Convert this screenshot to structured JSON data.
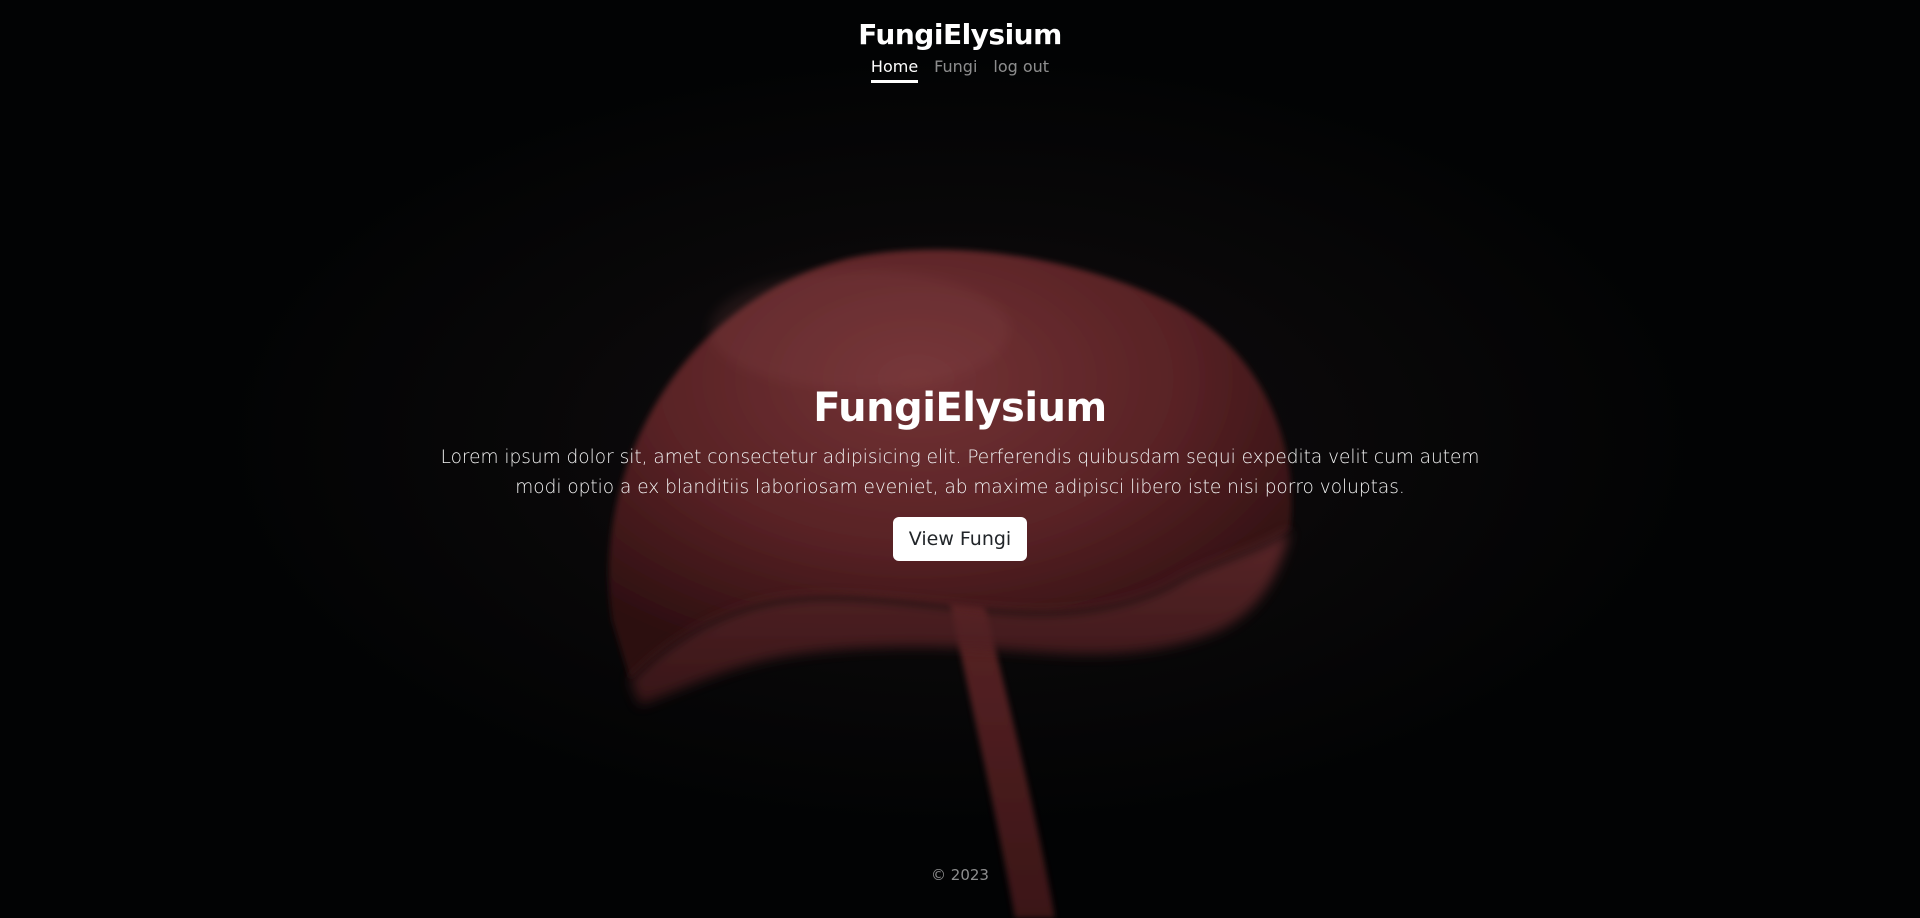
{
  "header": {
    "brand": "FungiElysium",
    "nav": [
      {
        "label": "Home",
        "active": true
      },
      {
        "label": "Fungi",
        "active": false
      },
      {
        "label": "log out",
        "active": false
      }
    ]
  },
  "hero": {
    "title": "FungiElysium",
    "text": "Lorem ipsum dolor sit, amet consectetur adipisicing elit. Perferendis quibusdam sequi expedita velit cum autem modi optio a ex blanditiis laboriosam eveniet, ab maxime adipisci libero iste nisi porro voluptas.",
    "button_label": "View Fungi"
  },
  "footer": {
    "copyright": "© 2023"
  },
  "colors": {
    "background": "#050607",
    "mushroom_cap": "#7a2e32",
    "mushroom_stem": "#9a3b3e",
    "button_bg": "#ffffff",
    "text": "#ffffff"
  }
}
